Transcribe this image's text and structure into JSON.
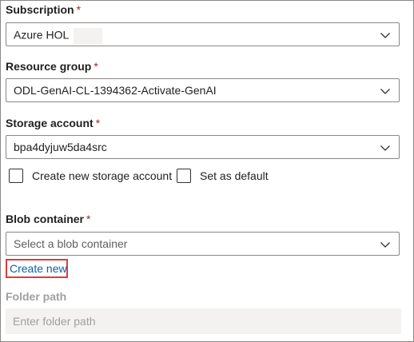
{
  "subscription": {
    "label": "Subscription",
    "required_marker": "*",
    "value": "Azure HOL",
    "icon": "chevron-down-icon"
  },
  "resource_group": {
    "label": "Resource group",
    "required_marker": "*",
    "value": "ODL-GenAI-CL-1394362-Activate-GenAI",
    "icon": "chevron-down-icon"
  },
  "storage_account": {
    "label": "Storage account",
    "required_marker": "*",
    "value": "bpa4dyjuw5da4src",
    "icon": "chevron-down-icon",
    "create_new_checkbox_label": "Create new storage account",
    "set_default_checkbox_label": "Set as default"
  },
  "blob_container": {
    "label": "Blob container",
    "required_marker": "*",
    "placeholder": "Select a blob container",
    "icon": "chevron-down-icon",
    "create_new_link": "Create new"
  },
  "folder_path": {
    "label": "Folder path",
    "placeholder": "Enter folder path"
  },
  "colors": {
    "required": "#a4262c",
    "link": "#0e5fa8",
    "highlight_border": "#e03a3a",
    "disabled_text": "#a19f9d",
    "disabled_field": "#f3f2f1"
  }
}
